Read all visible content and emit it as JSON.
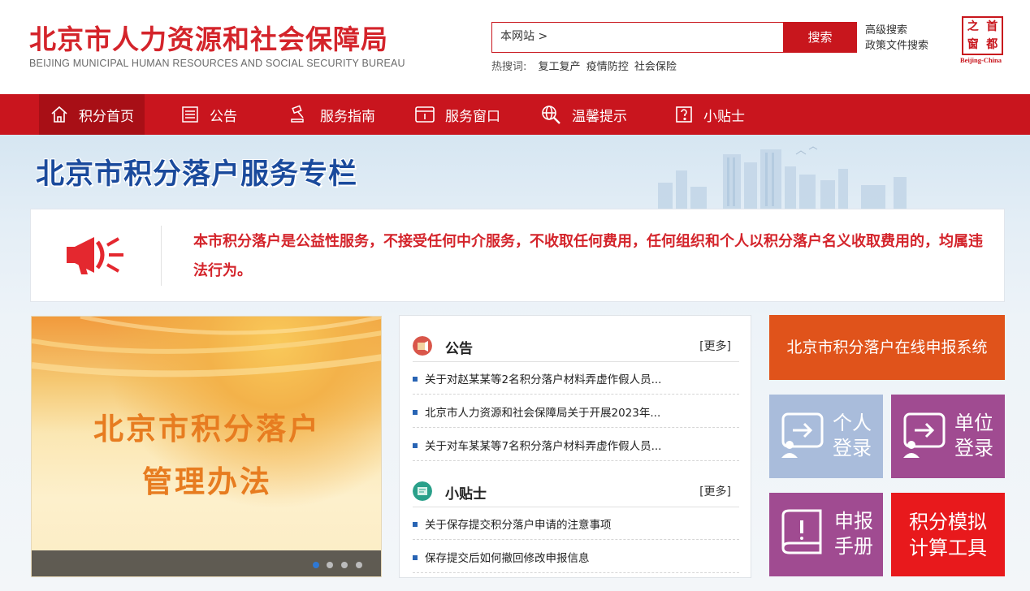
{
  "header": {
    "logo_cn": "北京市人力资源和社会保障局",
    "logo_en": "BEIJING MUNICIPAL HUMAN RESOURCES AND SOCIAL SECURITY BUREAU",
    "search_scope": "本网站 >",
    "search_button": "搜索",
    "advanced_search": "高级搜索",
    "policy_search": "政策文件搜索",
    "hot_label": "热搜词:",
    "hot_words": [
      "复工复产",
      "疫情防控",
      "社会保险"
    ],
    "seal_chars": [
      "之",
      "首",
      "窗",
      "都"
    ],
    "seal_en": "Beijing-China"
  },
  "nav": {
    "items": [
      {
        "label": "积分首页",
        "icon": "home-icon",
        "active": true
      },
      {
        "label": "公告",
        "icon": "news-icon",
        "active": false
      },
      {
        "label": "服务指南",
        "icon": "gavel-icon",
        "active": false
      },
      {
        "label": "服务窗口",
        "icon": "window-icon",
        "active": false
      },
      {
        "label": "温馨提示",
        "icon": "search-globe-icon",
        "active": false
      },
      {
        "label": "小贴士",
        "icon": "question-icon",
        "active": false
      }
    ]
  },
  "banner": {
    "title": "北京市积分落户服务专栏"
  },
  "notice": {
    "text": "本市积分落户是公益性服务，不接受任何中介服务，不收取任何费用，任何组织和个人以积分落户名义收取费用的，均属违法行为。",
    "icon": "megaphone-icon"
  },
  "slideshow": {
    "title_line1": "北京市积分落户",
    "title_line2": "管理办法",
    "dots": 4,
    "active_dot": 0
  },
  "announcements": {
    "title": "公告",
    "more": "[更多]",
    "items": [
      "关于对赵某某等2名积分落户材料弄虚作假人员...",
      "北京市人力资源和社会保障局关于开展2023年...",
      "关于对车某某等7名积分落户材料弄虚作假人员..."
    ]
  },
  "tips": {
    "title": "小贴士",
    "more": "[更多]",
    "items": [
      "关于保存提交积分落户申请的注意事项",
      "保存提交后如何撤回修改申报信息"
    ]
  },
  "tiles": {
    "apply": "北京市积分落户在线申报系统",
    "personal_line1": "个人",
    "personal_line2": "登录",
    "unit_line1": "单位",
    "unit_line2": "登录",
    "manual_line1": "申报",
    "manual_line2": "手册",
    "calc_line1": "积分模拟",
    "calc_line2": "计算工具"
  }
}
